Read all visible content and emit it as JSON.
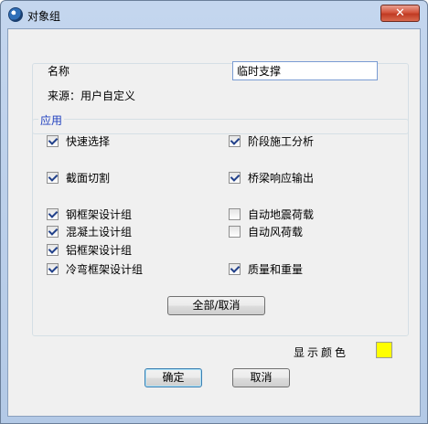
{
  "window": {
    "title": "对象组",
    "close_label": "✕"
  },
  "top": {
    "name_label": "名称",
    "name_value": "临时支撑",
    "source_label": "来源：用户自定义"
  },
  "application": {
    "caption": "应用",
    "left_items": [
      {
        "label": "快速选择",
        "checked": true
      },
      {
        "label": "截面切割",
        "checked": true
      },
      {
        "label": "钢框架设计组",
        "checked": true
      },
      {
        "label": "混凝土设计组",
        "checked": true
      },
      {
        "label": "铝框架设计组",
        "checked": true
      },
      {
        "label": "冷弯框架设计组",
        "checked": true
      }
    ],
    "right_items": [
      {
        "label": "阶段施工分析",
        "checked": true
      },
      {
        "label": "桥梁响应输出",
        "checked": true
      },
      {
        "label": "自动地震荷载",
        "checked": false
      },
      {
        "label": "自动风荷载",
        "checked": false
      },
      {
        "label": "质量和重量",
        "checked": true
      }
    ],
    "toggle_all_label": "全部/取消"
  },
  "display_color": {
    "label": "显示颜色",
    "color": "#ffff00"
  },
  "footer": {
    "ok_label": "确定",
    "cancel_label": "取消"
  }
}
